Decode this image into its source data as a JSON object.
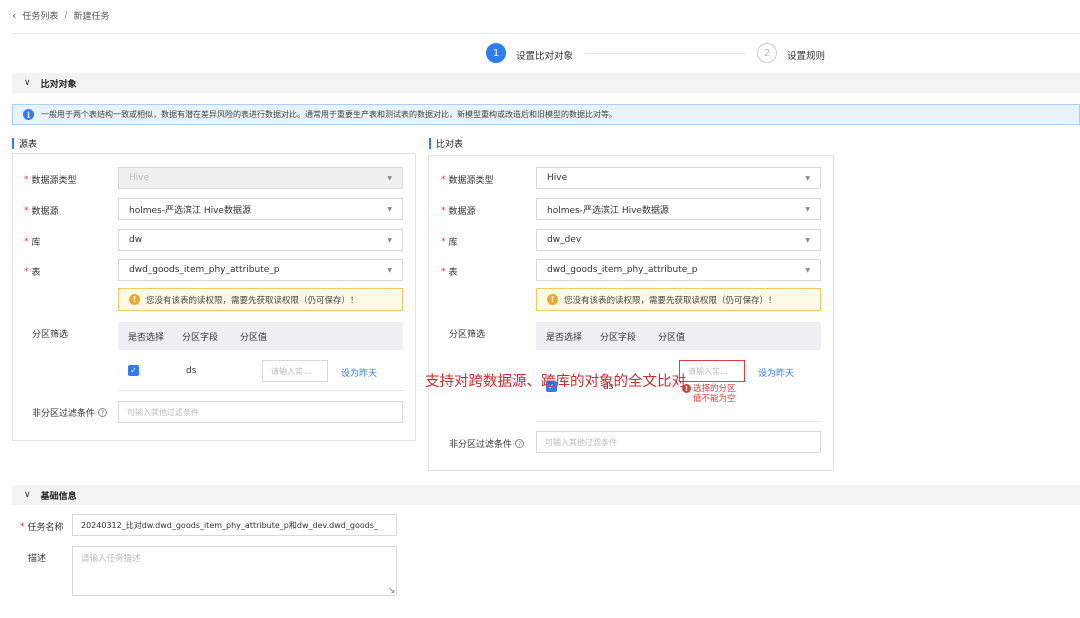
{
  "breadcrumb": {
    "back_icon": "chevron-left-icon",
    "parent": "任务列表",
    "separator": "/",
    "current": "新建任务"
  },
  "steps": [
    {
      "number": "1",
      "label": "设置比对对象",
      "active": true
    },
    {
      "number": "2",
      "label": "设置规则",
      "active": false
    }
  ],
  "sections": {
    "compare_objects": "比对对象",
    "basic_info": "基础信息"
  },
  "info_text": "一般用于两个表结构一致或相似，数据有潜在差异风险的表进行数据对比。通常用于重要生产表和测试表的数据对比，新模型重构或改造后和旧模型的数据比对等。",
  "labels": {
    "datasource_type": "数据源类型",
    "datasource": "数据源",
    "database": "库",
    "table": "表",
    "partition_filter": "分区筛选",
    "col_select": "是否选择",
    "col_field": "分区字段",
    "col_value": "分区值",
    "non_partition_filter": "非分区过滤条件",
    "set_yesterday": "设为昨天"
  },
  "source": {
    "title": "源表",
    "datasource_type": "Hive",
    "datasource": "holmes-严选滨江 Hive数据源",
    "database": "dw",
    "table": "dwd_goods_item_phy_attribute_p",
    "warning": "您没有该表的读权限，需要先获取读权限（仍可保存）！",
    "partition_field": "ds",
    "partition_value_placeholder": "请输入实...",
    "filter_placeholder": "可输入其他过滤条件"
  },
  "target": {
    "title": "比对表",
    "datasource_type": "Hive",
    "datasource": "holmes-严选滨江 Hive数据源",
    "database": "dw_dev",
    "table": "dwd_goods_item_phy_attribute_p",
    "warning": "您没有该表的读权限，需要先获取读权限（仍可保存）！",
    "partition_field": "ds",
    "partition_value_placeholder": "请输入实...",
    "error_line1": "选择的分区",
    "error_line2": "值不能为空",
    "filter_placeholder": "可输入其他过滤条件"
  },
  "annotation": "支持对跨数据源、跨库的对象的全文比对",
  "basic": {
    "task_name_label": "任务名称",
    "task_name_value": "20240312_比对dw.dwd_goods_item_phy_attribute_p和dw_dev.dwd_goods_",
    "desc_label": "描述",
    "desc_placeholder": "请输入任务描述"
  },
  "colors": {
    "accent": "#2f7cf6",
    "error": "#e03e3e",
    "warning_bg": "#fffbe6",
    "info_bg": "#e8f3fe"
  }
}
